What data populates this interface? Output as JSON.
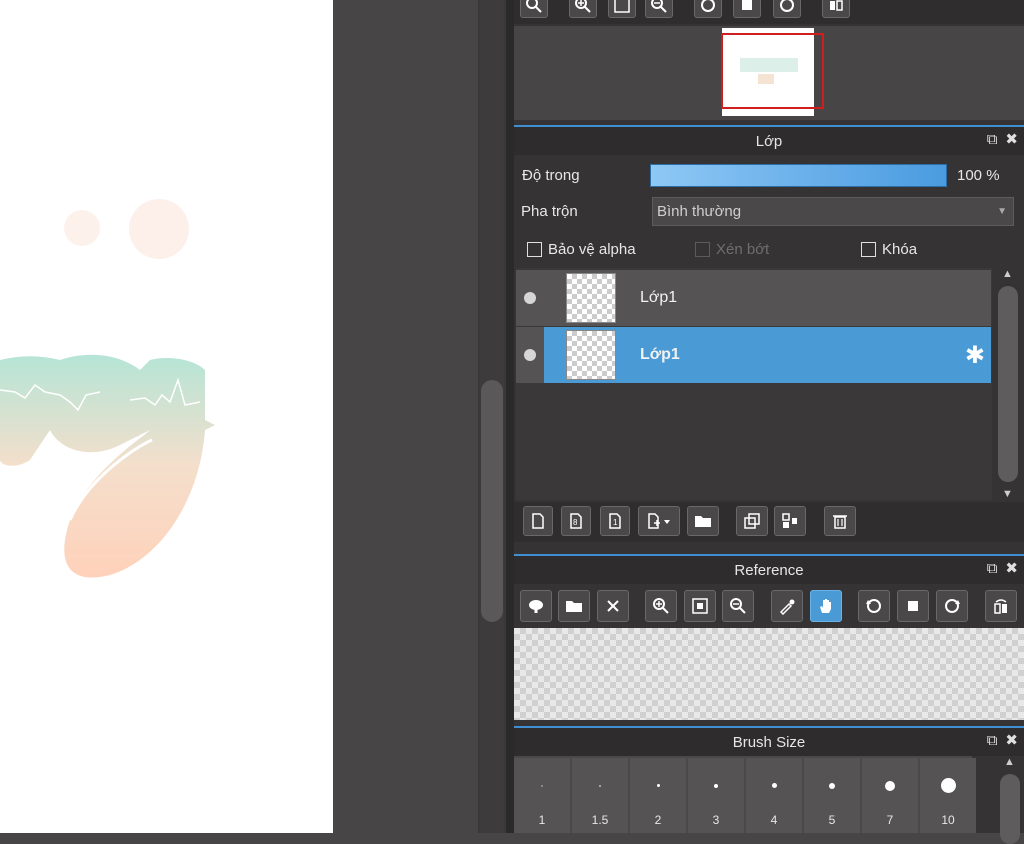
{
  "navigator": {
    "toolbar_icons": [
      "zoom-in-icon",
      "zoom-in-icon",
      "fit-window-icon",
      "zoom-out-icon",
      "rotate-left-icon",
      "reset-rotation-icon",
      "rotate-right-icon",
      "flip-horizontal-icon"
    ]
  },
  "layer_panel": {
    "title": "Lớp",
    "opacity_label": "Độ trong",
    "opacity_value": "100 %",
    "opacity_level": 1.0,
    "blend_label": "Pha trộn",
    "blend_value": "Bình thường",
    "protect_alpha": "Bảo vệ alpha",
    "clipping": "Xén bớt",
    "lock": "Khóa",
    "layers": [
      {
        "name": "Lớp1",
        "selected": false
      },
      {
        "name": "Lớp1",
        "selected": true
      }
    ]
  },
  "reference_panel": {
    "title": "Reference"
  },
  "brush_panel": {
    "title": "Brush Size",
    "sizes": [
      "1",
      "1.5",
      "2",
      "3",
      "4",
      "5",
      "7",
      "10"
    ]
  },
  "colors": {
    "accent": "#3f8fd2",
    "selected_row": "#4a9ad6",
    "panel_bg": "#353333"
  }
}
